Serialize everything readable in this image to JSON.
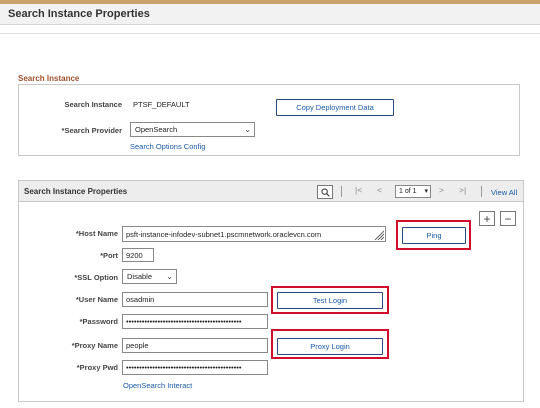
{
  "page": {
    "title": "Search Instance Properties"
  },
  "search_instance": {
    "section_label": "Search Instance",
    "search_instance_label": "Search Instance",
    "search_instance_value": "PTSF_DEFAULT",
    "copy_button": "Copy Deployment Data",
    "search_provider_label": "*Search Provider",
    "search_provider_value": "OpenSearch",
    "search_options_link": "Search Options Config"
  },
  "properties": {
    "grid_title": "Search Instance Properties",
    "pager_value": "1 of 1",
    "view_all": "View All",
    "host_name_label": "*Host Name",
    "host_name_value": "psft-instance-infodev-subnet1.pscmnetwork.oraclevcn.com",
    "ping_button": "Ping",
    "port_label": "*Port",
    "port_value": "9200",
    "ssl_label": "*SSL Option",
    "ssl_value": "Disable",
    "user_label": "*User Name",
    "user_value": "osadmin",
    "test_login_button": "Test Login",
    "password_label": "*Password",
    "password_value": "••••••••••••••••••••••••••••••••••••••••••••",
    "proxy_name_label": "*Proxy Name",
    "proxy_name_value": "people",
    "proxy_login_button": "Proxy Login",
    "proxy_pwd_label": "*Proxy Pwd",
    "proxy_pwd_value": "••••••••••••••••••••••••••••••••••••••••••••",
    "interact_link": "OpenSearch Interact",
    "add_symbol": "+",
    "remove_symbol": "−"
  },
  "icons": {
    "search": "search-icon",
    "first": "first-page-icon",
    "prev": "previous-page-icon",
    "next": "next-page-icon",
    "last": "last-page-icon",
    "pager_chevron": "▾",
    "select_chevron": "⌄"
  },
  "colors": {
    "highlight": "#d0102a",
    "link": "#1a5aa6",
    "section_label": "#a0522d",
    "button_border": "#2c4a86"
  }
}
